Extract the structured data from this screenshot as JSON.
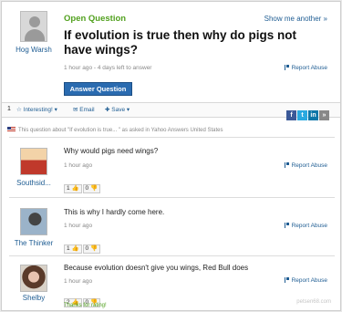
{
  "question": {
    "status": "Open Question",
    "show_more": "Show me another »",
    "asker": "Hog Warsh",
    "title": "If evolution is true then why do pigs not have wings?",
    "meta": "1 hour ago - 4 days left to answer",
    "report": "Report Abuse",
    "answer_button": "Answer Question"
  },
  "toolbar": {
    "count": "1",
    "interesting": "Interesting!",
    "email": "Email",
    "save": "Save"
  },
  "about": "This question about \"If evolution is true... \" as asked in Yahoo Answers United States",
  "answers": [
    {
      "name": "Southsid...",
      "text": "Why would pigs need wings?",
      "time": "1 hour ago",
      "report": "Report Abuse",
      "up": "1",
      "down": "0"
    },
    {
      "name": "The Thinker",
      "text": "This is why I hardly come here.",
      "time": "1 hour ago",
      "report": "Report Abuse",
      "up": "1",
      "down": "0"
    },
    {
      "name": "Shelby",
      "text": "Because evolution doesn't give you wings, Red Bull does",
      "time": "1 hour ago",
      "report": "Report Abuse",
      "up": "2",
      "down": "0",
      "thanks": "Thanks for rating!"
    }
  ],
  "watermark": "petsen68.com"
}
